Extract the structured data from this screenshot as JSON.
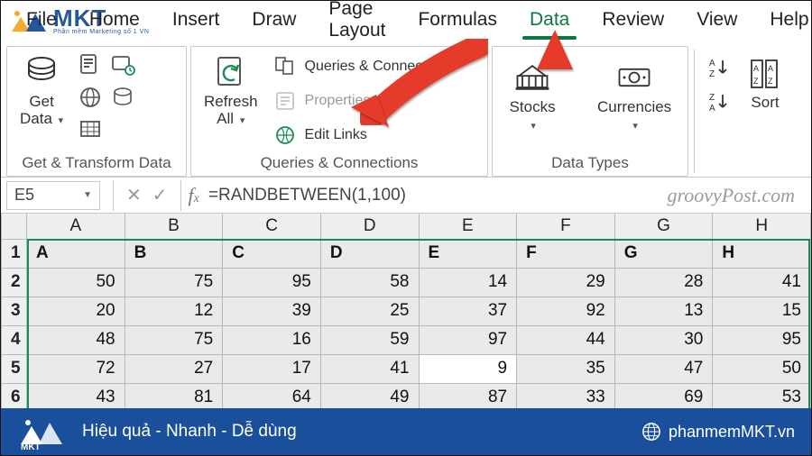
{
  "tabs": [
    "File",
    "Home",
    "Insert",
    "Draw",
    "Page Layout",
    "Formulas",
    "Data",
    "Review",
    "View",
    "Help"
  ],
  "active_tab_index": 6,
  "ribbon": {
    "group1_label": "Get & Transform Data",
    "get_data": "Get\nData",
    "refresh_all": "Refresh\nAll",
    "qc_group_label": "Queries & Connections",
    "qc_btn": "Queries & Connections",
    "properties": "Properties",
    "edit_links": "Edit Links",
    "stocks": "Stocks",
    "currencies": "Currencies",
    "data_types_label": "Data Types",
    "sort": "Sort"
  },
  "formula_bar": {
    "name_box": "E5",
    "formula": "=RANDBETWEEN(1,100)",
    "watermark": "groovyPost.com"
  },
  "columns": [
    "A",
    "B",
    "C",
    "D",
    "E",
    "F",
    "G",
    "H"
  ],
  "header_row": [
    "A",
    "B",
    "C",
    "D",
    "E",
    "F",
    "G",
    "H"
  ],
  "rows": [
    [
      50,
      75,
      95,
      58,
      14,
      29,
      28,
      41
    ],
    [
      20,
      12,
      39,
      25,
      37,
      92,
      13,
      15
    ],
    [
      48,
      75,
      16,
      59,
      97,
      44,
      30,
      95
    ],
    [
      72,
      27,
      17,
      41,
      9,
      35,
      47,
      50
    ],
    [
      43,
      81,
      64,
      49,
      87,
      33,
      69,
      53
    ]
  ],
  "active_cell": {
    "row_index": 3,
    "col_index": 4
  },
  "footer": {
    "slogan": "Hiệu quả - Nhanh  - Dễ dùng",
    "site": "phanmemMKT.vn"
  },
  "brand": {
    "name": "MKT",
    "sub": "Phần mềm Marketing số 1 VN"
  }
}
